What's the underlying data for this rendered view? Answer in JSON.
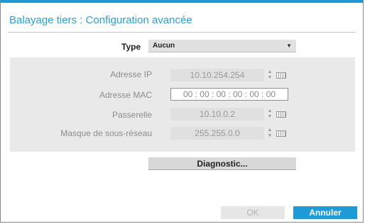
{
  "dialog": {
    "title": "Balayage tiers : Configuration avancée"
  },
  "type_row": {
    "label": "Type",
    "selected": "Aucun"
  },
  "network": {
    "ip_label": "Adresse IP",
    "ip_value": "10.10.254.254",
    "mac_label": "Adresse MAC",
    "mac_value": "00 : 00 : 00 : 00 : 00 : 00",
    "gateway_label": "Passerelle",
    "gateway_value": "10.10.0.2",
    "subnet_label": "Masque de sous-réseau",
    "subnet_value": "255.255.0.0"
  },
  "actions": {
    "diagnostic": "Diagnostic...",
    "ok": "OK",
    "cancel": "Annuler"
  },
  "colors": {
    "accent": "#1f9ad6",
    "panel": "#e9e9e9",
    "disabled_text": "#999999"
  },
  "icons": {
    "spinner": "spin-up-down-icon",
    "keyboard": "virtual-keyboard-icon",
    "dropdown": "chevron-down-icon"
  }
}
